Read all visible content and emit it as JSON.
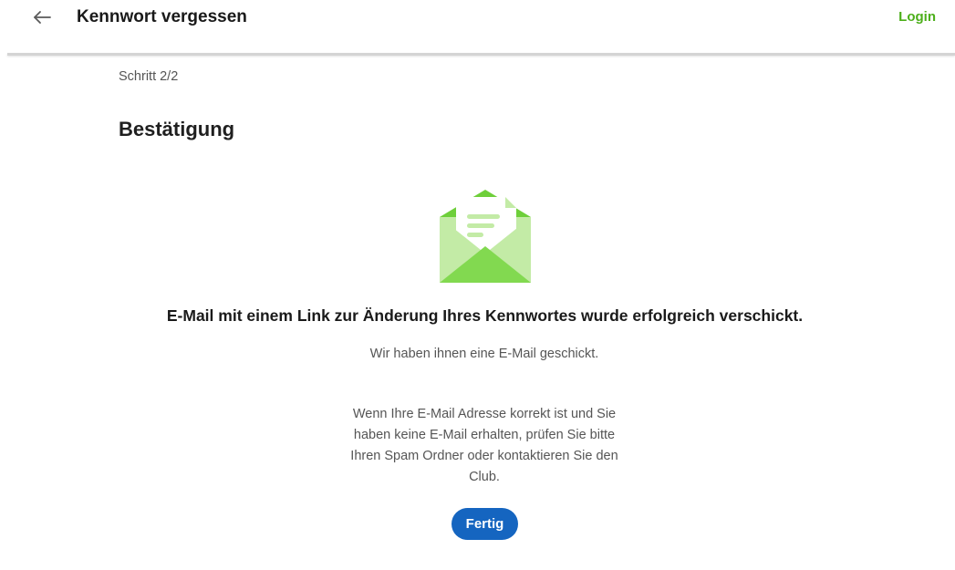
{
  "header": {
    "title": "Kennwort vergessen",
    "login_label": "Login",
    "back_icon": "arrow-left-icon"
  },
  "step": {
    "label": "Schritt 2/2"
  },
  "page": {
    "title": "Bestätigung",
    "illustration_icon": "email-sent-icon",
    "success_message": "E-Mail mit einem Link zur Änderung Ihres Kennwortes wurde erfolgreich verschickt.",
    "info_line_1": "Wir haben ihnen eine E-Mail geschickt.",
    "info_line_2": "Wenn Ihre E-Mail Adresse korrekt ist und Sie haben keine E-Mail erhalten, prüfen Sie bitte Ihren Spam Ordner oder kontaktieren Sie den Club.",
    "done_label": "Fertig"
  },
  "colors": {
    "accent_green": "#4caf1a",
    "primary_blue": "#1565c0",
    "envelope_dark": "#6ecf3a",
    "envelope_light": "#c3eba6"
  }
}
